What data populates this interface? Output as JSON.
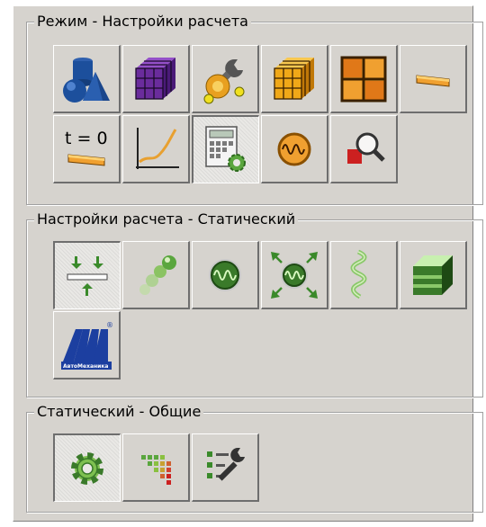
{
  "groups": {
    "mode": {
      "title": "Режим - Настройки расчета"
    },
    "static_settings": {
      "title": "Настройки расчета - Статический"
    },
    "static_general": {
      "title": "Статический - Общие"
    }
  },
  "icons": {
    "time_zero_label": "t = 0",
    "apm_brand": "АвтоМеханика",
    "apm_registered": "®"
  },
  "colors": {
    "panel_bg": "#d6d3ce",
    "bevel_light": "#ffffff",
    "bevel_dark": "#6e6e6e",
    "accent_blue": "#1c4f9c",
    "accent_orange": "#e8a030",
    "accent_green": "#4a9a3a"
  }
}
